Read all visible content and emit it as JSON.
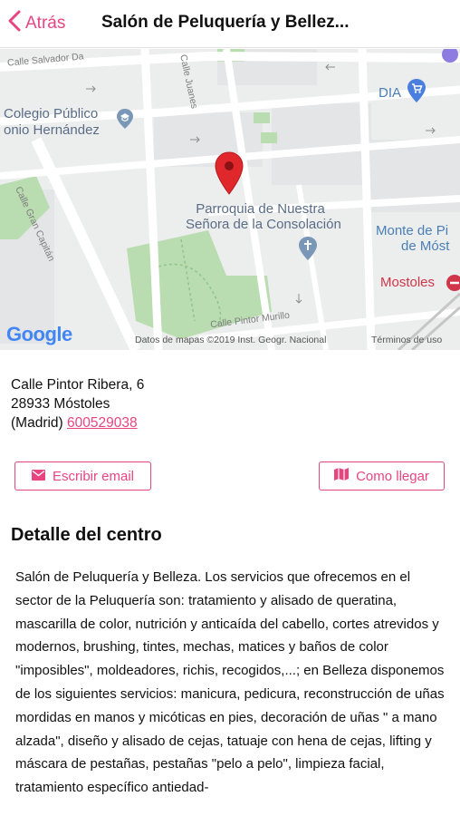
{
  "header": {
    "back_label": "Atrás",
    "title": "Salón de Peluquería y Bellez..."
  },
  "map": {
    "streets": {
      "salvador": "Calle Salvador Da",
      "juanes": "Calle Juanes",
      "gran_capitan": "Calle Gran Capitán",
      "pintor_murillo": "Calle Pintor Murillo"
    },
    "pois": {
      "colegio_line1": "Colegio Público",
      "colegio_line2": "onio Hernández",
      "dia": "DIA",
      "parroquia_line1": "Parroquia de Nuestra",
      "parroquia_line2": "Señora de la Consolación",
      "monte_line1": "Monte de Pi",
      "monte_line2": "de Móst",
      "mostoles": "Mostoles"
    },
    "logo": "Google",
    "attribution": "Datos de mapas ©2019 Inst. Geogr. Nacional",
    "terms": "Términos de uso"
  },
  "address": {
    "line1": "Calle Pintor Ribera, 6",
    "line2": "28933 Móstoles",
    "region": "(Madrid)",
    "phone": "600529038"
  },
  "actions": {
    "email_label": "Escribir email",
    "route_label": "Como llegar"
  },
  "detail": {
    "title": "Detalle del centro",
    "text": "Salón de Peluquería y Belleza. Los servicios que ofrecemos en el sector de la Peluquería son: tratamiento y alisado de queratina, mascarilla de color, nutrición y anticaída del cabello, cortes atrevidos y modernos, brushing, tintes, mechas, matices y baños de color \"imposibles\", moldeadores, richis, recogidos,...; en Belleza disponemos de los siguientes servicios: manicura, pedicura, reconstrucción de uñas mordidas en manos y micóticas en pies, decoración de uñas \" a mano alzada\", diseño y alisado de cejas, tatuaje con hena de cejas, lifting y máscara de pestañas, pestañas \"pelo a pelo\", limpieza facial, tratamiento específico antiedad-"
  },
  "colors": {
    "accent": "#e8457f",
    "map_bg": "#eceded",
    "park": "#b9dcb0"
  }
}
